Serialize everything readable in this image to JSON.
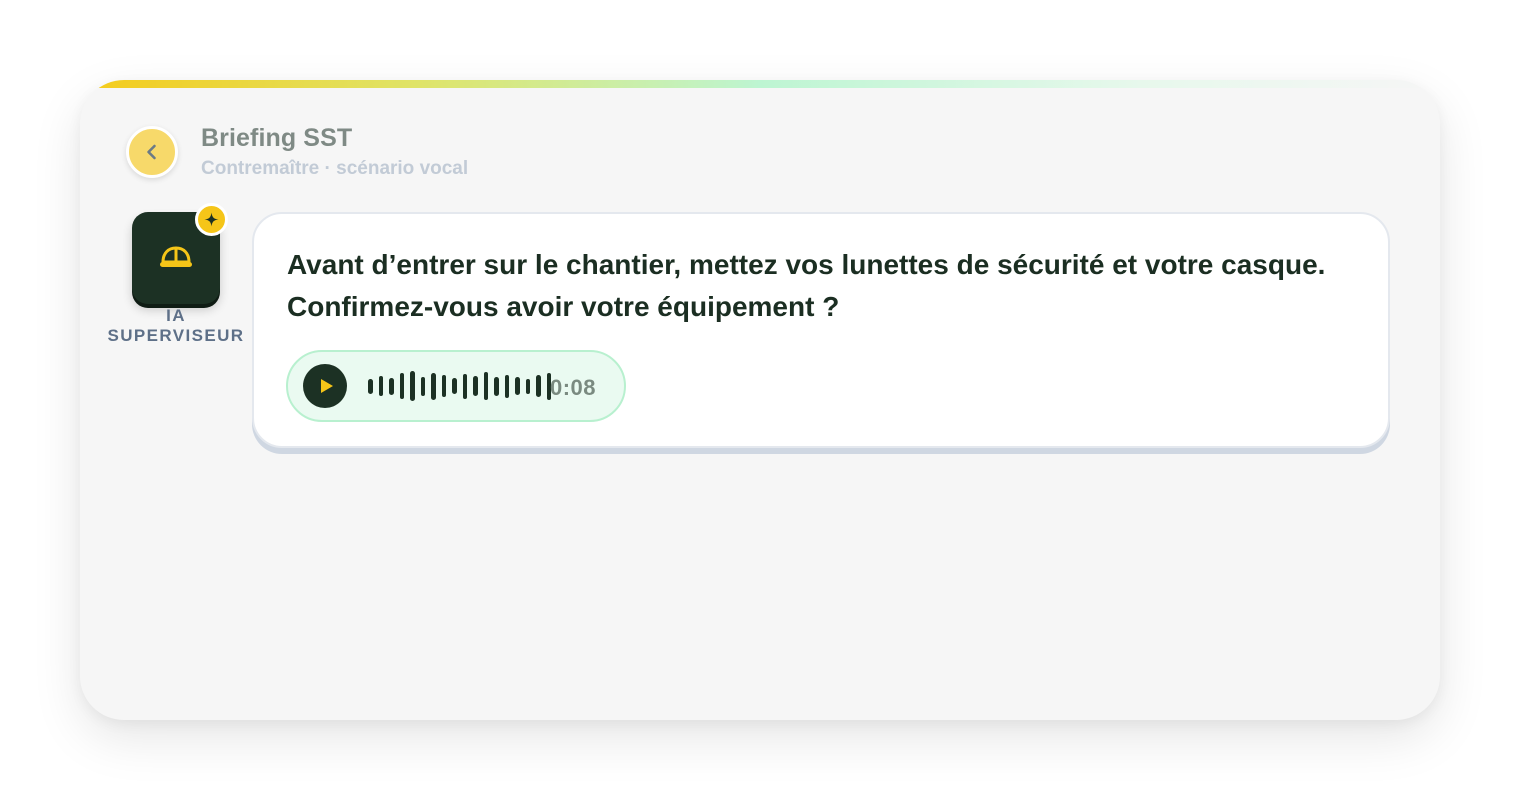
{
  "header": {
    "title": "Briefing SST",
    "subtitle": "Contremaître · scénario vocal"
  },
  "icons": {
    "back": "chevron-left-icon",
    "avatar": "hard-hat-icon",
    "badge": "sparkle-icon",
    "play": "play-icon"
  },
  "avatar": {
    "label": "IA SUPERVISEUR"
  },
  "message": {
    "text": "Avant d’entrer sur le chantier, mettez vos lunettes de sécurité et votre casque. Confirmez-vous avoir votre équipement ?",
    "audio": {
      "duration": "0:08",
      "waveform_levels": [
        0.3,
        0.55,
        0.4,
        0.8,
        1.0,
        0.5,
        0.85,
        0.65,
        0.35,
        0.75,
        0.55,
        0.9,
        0.5,
        0.7,
        0.45,
        0.3,
        0.65,
        0.85
      ]
    }
  },
  "colors": {
    "accent_yellow": "#f5c518",
    "dark_green": "#1c3124",
    "audio_bg": "#eafaf1",
    "audio_border": "#b8f0cf"
  }
}
